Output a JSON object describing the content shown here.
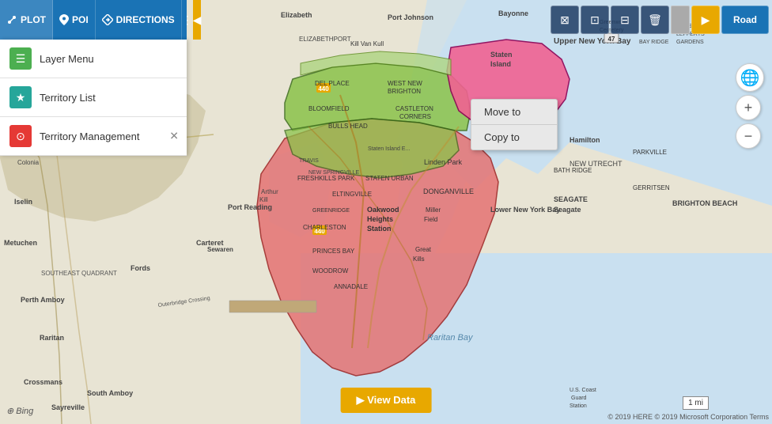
{
  "toolbar": {
    "plot_label": "PLOT",
    "poi_label": "POI",
    "directions_label": "DIRECTIONS",
    "collapse_icon": "◀"
  },
  "right_toolbar": {
    "road_label": "Road",
    "buttons": [
      "⊠",
      "⊡",
      "⊟",
      "🗑"
    ]
  },
  "side_panel": {
    "items": [
      {
        "id": "layer-menu",
        "label": "Layer Menu",
        "icon": "☰",
        "color": "green"
      },
      {
        "id": "territory-list",
        "label": "Territory List",
        "icon": "★",
        "color": "teal"
      },
      {
        "id": "territory-management",
        "label": "Territory Management",
        "icon": "⊙",
        "color": "red"
      }
    ]
  },
  "context_menu": {
    "items": [
      {
        "id": "move-to",
        "label": "Move to"
      },
      {
        "id": "copy-to",
        "label": "Copy to"
      }
    ]
  },
  "view_data": {
    "label": "▶ View Data"
  },
  "map": {
    "scale": "1 mi",
    "attribution": "© 2019 HERE  © 2019 Microsoft Corporation  Terms"
  },
  "bing": {
    "label": "⊕ Bing"
  },
  "map_controls": {
    "zoom_in": "+",
    "zoom_out": "−"
  }
}
